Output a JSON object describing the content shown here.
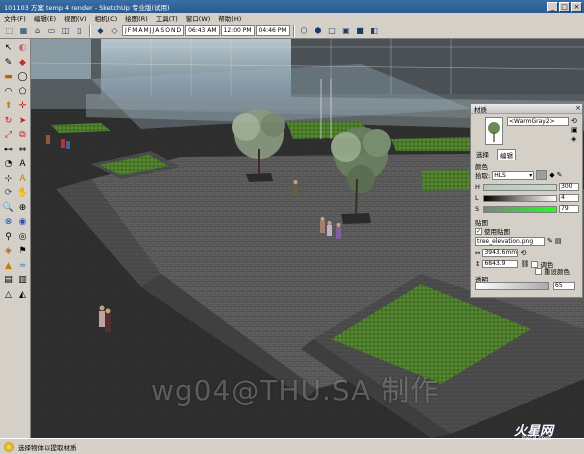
{
  "window": {
    "title": "101103 方案 temp 4 render - SketchUp 专业版(试用)",
    "buttons": [
      "_",
      "□",
      "×"
    ]
  },
  "menu": [
    "文件(F)",
    "编辑(E)",
    "视图(V)",
    "相机(C)",
    "绘图(R)",
    "工具(T)",
    "窗口(W)",
    "帮助(H)"
  ],
  "toolbar": {
    "months": [
      "J",
      "F",
      "M",
      "A",
      "M",
      "J",
      "J",
      "A",
      "S",
      "O",
      "N",
      "D"
    ],
    "time1": "06:43 AM",
    "time2": "12:00 PM",
    "time3": "04:46 PM"
  },
  "materials_panel": {
    "title": "材质",
    "material_name": "<WarmGray2>",
    "tabs": [
      "选择",
      "编辑"
    ],
    "color_section": "颜色",
    "picker_label": "拾取:",
    "picker_mode": "HLS",
    "slider_h": "300",
    "slider_l": "4",
    "slider_s": "79",
    "texture_section": "贴图",
    "use_texture_label": "使用贴图",
    "texture_file": "tree_elevation.png",
    "width_value": "3943.6mm",
    "height_value": "6843.9",
    "colorize_label": "调色",
    "reset_color_label": "重设颜色",
    "opacity_section": "透明",
    "opacity_value": "65"
  },
  "status": {
    "message": "选择物体以提取材质"
  },
  "overlay": {
    "watermark": "wg04@THU.SA 制作",
    "logo_big": "火星网",
    "logo_small": "hxsd.com"
  },
  "colors": {
    "title_bar": "#2a5a8f",
    "paving": "#5e5e5e",
    "grass": "#4a7a2a",
    "sky_glass": "#9ab3c2"
  },
  "icons": {
    "palette": [
      "select",
      "eraser",
      "line",
      "paint",
      "rectangle",
      "circle",
      "arc",
      "polygon",
      "push-pull",
      "move",
      "rotate",
      "follow-me",
      "scale",
      "offset",
      "tape",
      "dimension",
      "protractor",
      "text",
      "axes",
      "3d-text",
      "orbit",
      "pan",
      "zoom",
      "zoom-window",
      "zoom-extents",
      "prev-view",
      "walk",
      "look-around",
      "section",
      "position-camera",
      "sandbox",
      "smoove",
      "stamp",
      "drape",
      "detail",
      "flip"
    ]
  }
}
